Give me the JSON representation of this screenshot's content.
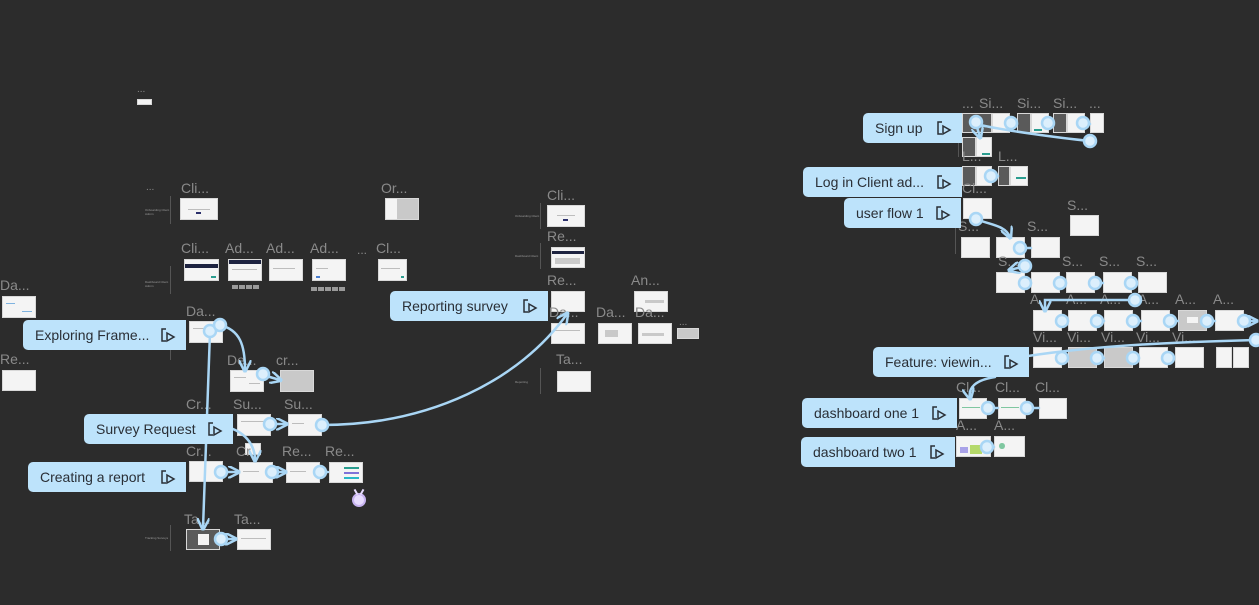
{
  "app": "Prototype canvas",
  "colors": {
    "canvas_bg": "#2c2c2c",
    "flow_button_bg": "#bde3fb",
    "connector": "#a9d6f5",
    "frame_label": "#8a8a8a",
    "collaborator_cursor": "#e8dcff"
  },
  "flow_starts": [
    {
      "id": "sign-up",
      "label": "Sign up",
      "icon": "play-icon"
    },
    {
      "id": "log-in-client-admin",
      "label": "Log in Client ad...",
      "icon": "play-icon"
    },
    {
      "id": "user-flow-1",
      "label": "user flow 1",
      "icon": "play-icon"
    },
    {
      "id": "feature-viewing",
      "label": "Feature: viewin...",
      "icon": "play-icon"
    },
    {
      "id": "dashboard-one-1",
      "label": "dashboard one 1",
      "icon": "play-icon"
    },
    {
      "id": "dashboard-two-1",
      "label": "dashboard two 1",
      "icon": "play-icon"
    },
    {
      "id": "reporting-survey",
      "label": "Reporting survey",
      "icon": "play-icon"
    },
    {
      "id": "exploring-frame",
      "label": "Exploring Frame...",
      "icon": "play-icon"
    },
    {
      "id": "survey-request",
      "label": "Survey Request",
      "icon": "play-icon"
    },
    {
      "id": "creating-report",
      "label": "Creating a report",
      "icon": "play-icon"
    }
  ],
  "frames": [
    {
      "label": "..."
    },
    {
      "label": "..."
    },
    {
      "label": "Cli..."
    },
    {
      "label": "Or..."
    },
    {
      "label": "Cli..."
    },
    {
      "label": "Ad..."
    },
    {
      "label": "Ad..."
    },
    {
      "label": "Ad..."
    },
    {
      "label": "..."
    },
    {
      "label": "Cl..."
    },
    {
      "label": "Da..."
    },
    {
      "label": "Re..."
    },
    {
      "label": "Da..."
    },
    {
      "label": "De..."
    },
    {
      "label": "cr..."
    },
    {
      "label": "Cr..."
    },
    {
      "label": "Su..."
    },
    {
      "label": "Su..."
    },
    {
      "label": "Cr..."
    },
    {
      "label": "Cr..."
    },
    {
      "label": "Re..."
    },
    {
      "label": "Re..."
    },
    {
      "label": "Ta..."
    },
    {
      "label": "Ta..."
    },
    {
      "label": "Cli..."
    },
    {
      "label": "Re..."
    },
    {
      "label": "Re..."
    },
    {
      "label": "An..."
    },
    {
      "label": "Da..."
    },
    {
      "label": "Da..."
    },
    {
      "label": "Da..."
    },
    {
      "label": "..."
    },
    {
      "label": "Ta..."
    },
    {
      "label": "..."
    },
    {
      "label": "Si..."
    },
    {
      "label": "Si..."
    },
    {
      "label": "Si..."
    },
    {
      "label": "..."
    },
    {
      "label": "L..."
    },
    {
      "label": "L..."
    },
    {
      "label": "Cl..."
    },
    {
      "label": "S..."
    },
    {
      "label": "S..."
    },
    {
      "label": "S..."
    },
    {
      "label": "S..."
    },
    {
      "label": "S..."
    },
    {
      "label": "S..."
    },
    {
      "label": "S..."
    },
    {
      "label": "A..."
    },
    {
      "label": "A..."
    },
    {
      "label": "A..."
    },
    {
      "label": "A..."
    },
    {
      "label": "A..."
    },
    {
      "label": "A..."
    },
    {
      "label": "Vi..."
    },
    {
      "label": "Vi..."
    },
    {
      "label": "Vi..."
    },
    {
      "label": "Vi..."
    },
    {
      "label": "Vi..."
    },
    {
      "label": "Cl..."
    },
    {
      "label": "Cl..."
    },
    {
      "label": "Cl..."
    },
    {
      "label": "A..."
    },
    {
      "label": "A..."
    }
  ],
  "sections": [
    {
      "label": "Onboarding Client Admin"
    },
    {
      "label": "Dashboard Client Admin"
    },
    {
      "label": "Onboarding Client"
    },
    {
      "label": "Dashboard Client"
    },
    {
      "label": "Reporting"
    },
    {
      "label": "Tracking Surveys"
    }
  ]
}
